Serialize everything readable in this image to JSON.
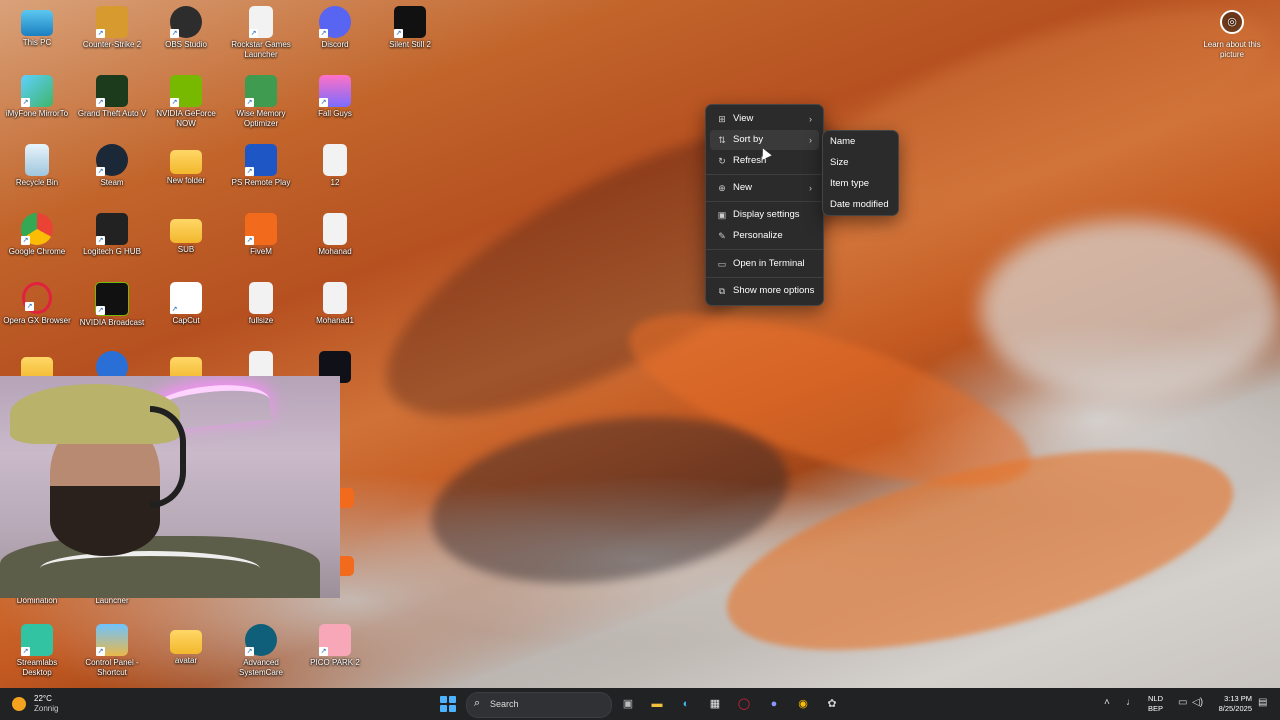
{
  "desktop_icons": [
    {
      "label": "This PC"
    },
    {
      "label": "Counter-Strike 2"
    },
    {
      "label": "OBS Studio"
    },
    {
      "label": "Rockstar Games Launcher"
    },
    {
      "label": "Discord"
    },
    {
      "label": "Silent Still 2"
    },
    {
      "label": "iMyFone MirrorTo"
    },
    {
      "label": "Grand Theft Auto V"
    },
    {
      "label": "NVIDIA GeForce NOW"
    },
    {
      "label": "Wise Memory Optimizer"
    },
    {
      "label": "Fall Guys"
    },
    {
      "label": "Recycle Bin"
    },
    {
      "label": "Steam"
    },
    {
      "label": "New folder"
    },
    {
      "label": "PS Remote Play"
    },
    {
      "label": "12"
    },
    {
      "label": "Google Chrome"
    },
    {
      "label": "Logitech G HUB"
    },
    {
      "label": "SUB"
    },
    {
      "label": "FiveM"
    },
    {
      "label": "Mohanad"
    },
    {
      "label": "Opera GX Browser"
    },
    {
      "label": "NVIDIA Broadcast"
    },
    {
      "label": "CapCut"
    },
    {
      "label": "fullsize"
    },
    {
      "label": "Mohanad1"
    },
    {
      "label": "Domination"
    },
    {
      "label": "Launcher"
    },
    {
      "label": "Streamlabs Desktop"
    },
    {
      "label": "Control Panel - Shortcut"
    },
    {
      "label": "avatar"
    },
    {
      "label": "Advanced SystemCare"
    },
    {
      "label": "PICO PARK 2"
    }
  ],
  "learn_about_picture": "Learn about this picture",
  "context_menu": {
    "items": [
      {
        "label": "View",
        "icon": "grid-icon"
      },
      {
        "label": "Sort by",
        "icon": "sort-icon"
      },
      {
        "label": "Refresh",
        "icon": "refresh-icon"
      },
      {
        "label": "New",
        "icon": "plus-circle-icon"
      },
      {
        "label": "Display settings",
        "icon": "display-icon"
      },
      {
        "label": "Personalize",
        "icon": "brush-icon"
      },
      {
        "label": "Open in Terminal",
        "icon": "terminal-icon"
      },
      {
        "label": "Show more options",
        "icon": "more-options-icon"
      }
    ]
  },
  "sort_submenu": {
    "items": [
      "Name",
      "Size",
      "Item type",
      "Date modified"
    ]
  },
  "taskbar": {
    "weather_temp": "22°C",
    "weather_desc": "Zonnig",
    "search_placeholder": "Search",
    "lang_top": "NLD",
    "lang_bottom": "BEP",
    "time": "3:13 PM",
    "date": "8/25/2025"
  },
  "colors": {
    "menu_bg": "#2b2b2b",
    "taskbar_bg": "#202224",
    "accent": "#4fb3ff"
  }
}
